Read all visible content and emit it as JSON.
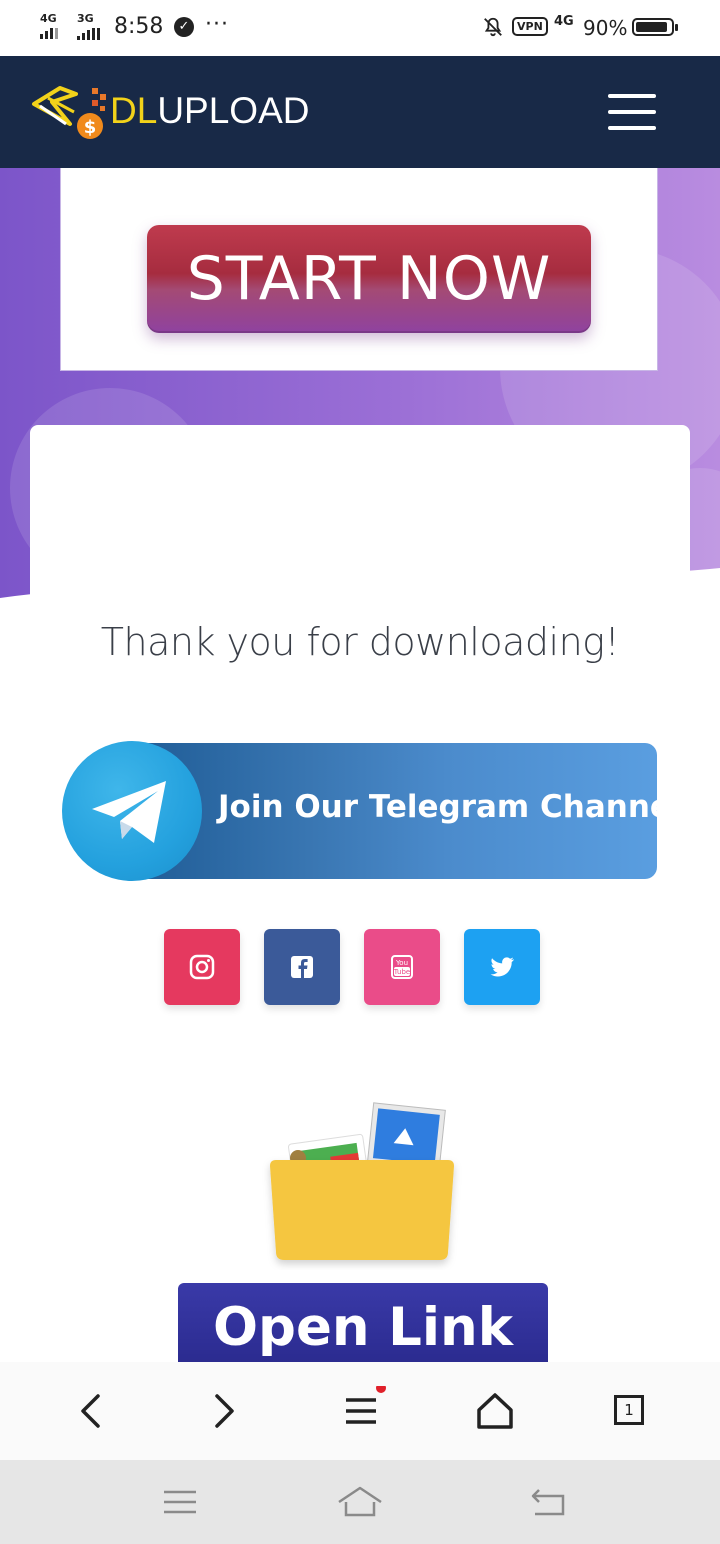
{
  "status_bar": {
    "network_1": "4G",
    "network_2": "3G",
    "time": "8:58",
    "more_dots": "···",
    "vpn_label": "VPN",
    "network_right": "4G",
    "battery_percent": "90%",
    "battery_level": 0.9
  },
  "header": {
    "brand_dl": "DL",
    "brand_rest": "UPLOAD",
    "menu_icon": "hamburger-icon"
  },
  "ad": {
    "start_label": "START NOW"
  },
  "main": {
    "thanks_text": "Thank you for downloading!",
    "telegram_label": "Join Our Telegram Channel",
    "open_link_label": "Open Link"
  },
  "socials": [
    {
      "name": "instagram-icon",
      "color": "#e5395f"
    },
    {
      "name": "facebook-icon",
      "color": "#3b5a99"
    },
    {
      "name": "youtube-icon",
      "color": "#ea4c89",
      "text_top": "You",
      "text_bottom": "Tube"
    },
    {
      "name": "twitter-icon",
      "color": "#1da1f2"
    }
  ],
  "browser_nav": {
    "tab_count": "1"
  },
  "colors": {
    "navbar": "#182947",
    "brand_accent": "#f2d21a",
    "purple": "#9b6fd6",
    "telegram": "#24a1de",
    "open_link": "#2a2a8e"
  }
}
